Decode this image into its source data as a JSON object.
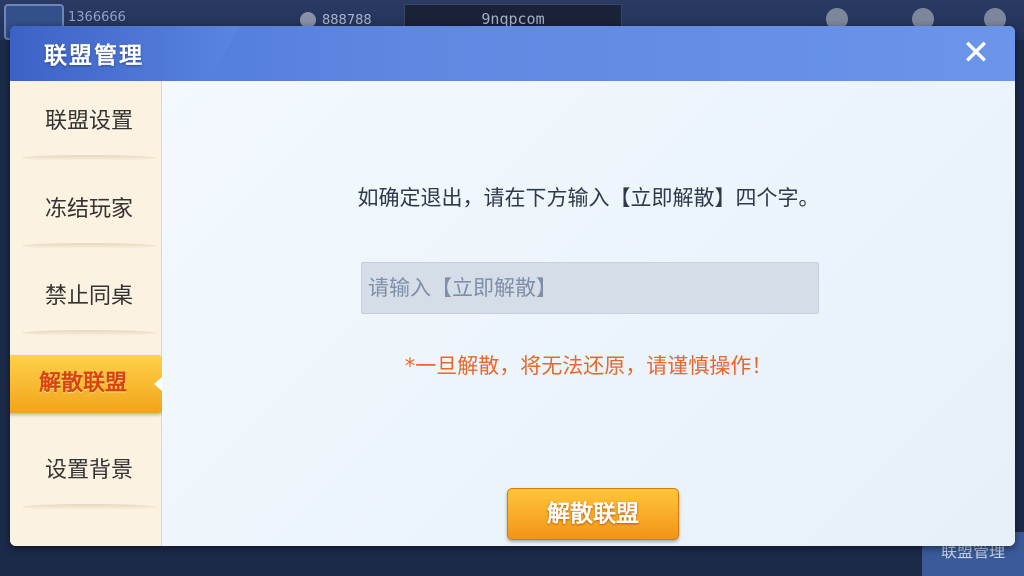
{
  "background": {
    "player_id": "1366666",
    "coins": "888788",
    "banner": "9nqpcom",
    "bottom_button": "联盟管理"
  },
  "dialog": {
    "title": "联盟管理",
    "close_icon": "close-icon"
  },
  "sidebar": {
    "items": [
      {
        "label": "联盟设置",
        "active": false
      },
      {
        "label": "冻结玩家",
        "active": false
      },
      {
        "label": "禁止同桌",
        "active": false
      },
      {
        "label": "解散联盟",
        "active": true
      },
      {
        "label": "设置背景",
        "active": false
      }
    ]
  },
  "main": {
    "instruction": "如确定退出，请在下方输入【立即解散】四个字。",
    "input": {
      "value": "",
      "placeholder": "请输入【立即解散】"
    },
    "warning": "*一旦解散，将无法还原，请谨慎操作！",
    "confirm_label": "解散联盟"
  },
  "colors": {
    "header_blue": "#5f88e2",
    "active_tab_orange": "#f2a41a",
    "warning_orange": "#e8672a",
    "sidebar_bg": "#fbf2e1"
  }
}
